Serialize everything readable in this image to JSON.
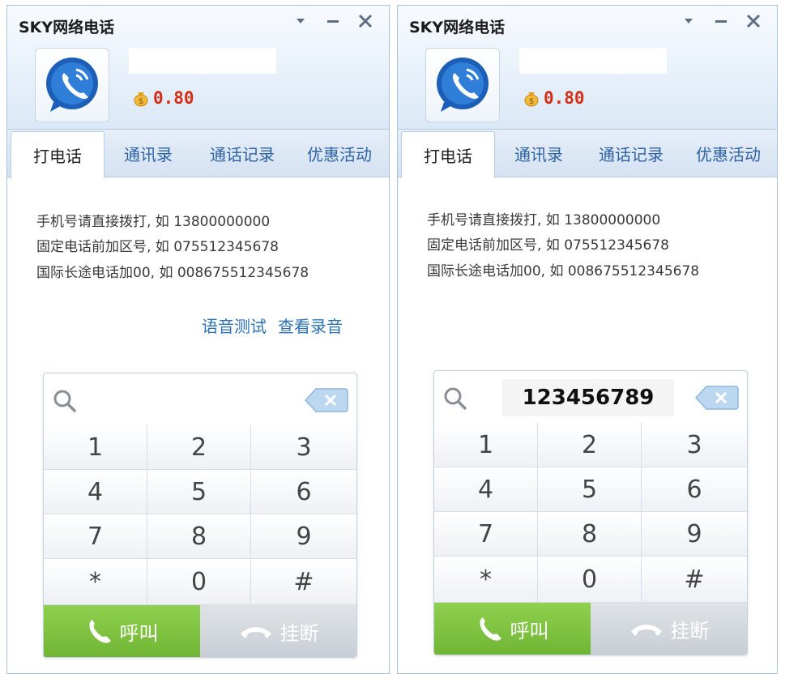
{
  "panels": [
    {
      "title": "SKY网络电话",
      "balance": "0.80",
      "tabs": [
        "打电话",
        "通讯录",
        "通话记录",
        "优惠活动"
      ],
      "hints": [
        "手机号请直接拨打, 如 13800000000",
        "固定电话前加区号, 如 075512345678",
        "国际长途电话加00, 如 008675512345678"
      ],
      "links": [
        "语音测试",
        "查看录音"
      ],
      "dialed_number": "",
      "keys": [
        "1",
        "2",
        "3",
        "4",
        "5",
        "6",
        "7",
        "8",
        "9",
        "*",
        "0",
        "#"
      ],
      "call_label": "呼叫",
      "hangup_label": "挂断"
    },
    {
      "title": "SKY网络电话",
      "balance": "0.80",
      "tabs": [
        "打电话",
        "通讯录",
        "通话记录",
        "优惠活动"
      ],
      "hints": [
        "手机号请直接拨打, 如 13800000000",
        "固定电话前加区号, 如 075512345678",
        "国际长途电话加00, 如 008675512345678"
      ],
      "links": [],
      "dialed_number": "123456789",
      "keys": [
        "1",
        "2",
        "3",
        "4",
        "5",
        "6",
        "7",
        "8",
        "9",
        "*",
        "0",
        "#"
      ],
      "call_label": "呼叫",
      "hangup_label": "挂断"
    }
  ],
  "icons": {
    "win_menu": "chevron-down-icon",
    "win_minimize": "minimize-icon",
    "win_close": "close-icon",
    "avatar": "phone-bubble-icon",
    "balance": "coin-bag-icon",
    "search": "search-icon",
    "backspace": "backspace-icon",
    "call": "phone-icon",
    "hangup": "hangup-icon"
  },
  "colors": {
    "call_green": "#7cc23f",
    "balance_red": "#d52e14",
    "link_blue": "#2b73b6",
    "tab_blue": "#2d62a3"
  }
}
